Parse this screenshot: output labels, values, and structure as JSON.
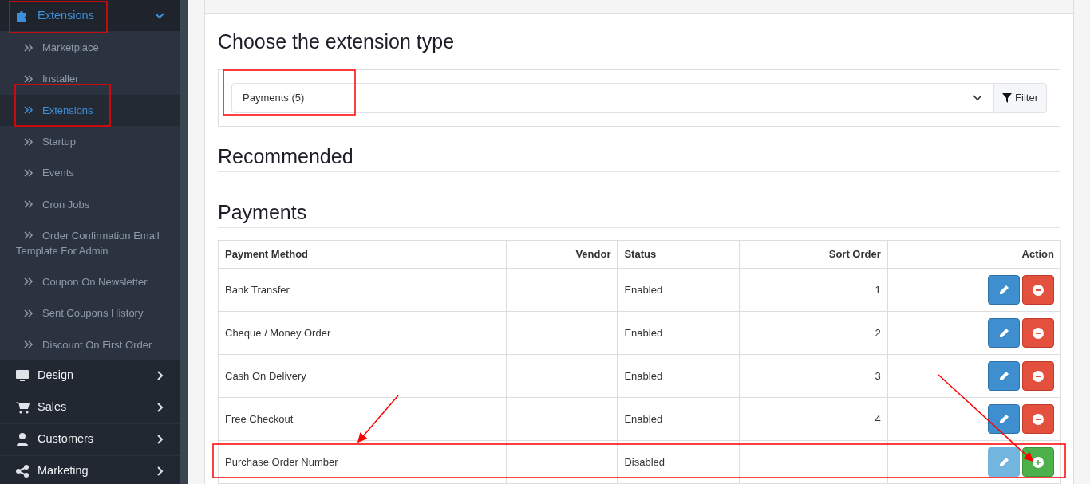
{
  "sidebar": {
    "items": [
      {
        "label": "Extensions",
        "expanded": true,
        "children": [
          {
            "label": "Marketplace",
            "selected": false
          },
          {
            "label": "Installer",
            "selected": false
          },
          {
            "label": "Extensions",
            "selected": true
          },
          {
            "label": "Startup",
            "selected": false
          },
          {
            "label": "Events",
            "selected": false
          },
          {
            "label": "Cron Jobs",
            "selected": false
          },
          {
            "label": "Order Confirmation Email Template For Admin",
            "selected": false
          },
          {
            "label": "Coupon On Newsletter",
            "selected": false
          },
          {
            "label": "Sent Coupons History",
            "selected": false
          },
          {
            "label": "Discount On First Order",
            "selected": false
          }
        ]
      },
      {
        "label": "Design",
        "expanded": false
      },
      {
        "label": "Sales",
        "expanded": false
      },
      {
        "label": "Customers",
        "expanded": false
      },
      {
        "label": "Marketing",
        "expanded": false
      }
    ]
  },
  "main": {
    "type_heading": "Choose the extension type",
    "type_select": {
      "value": "Payments (5)"
    },
    "filter_button": "Filter",
    "recommended_heading": "Recommended",
    "section_heading": "Payments",
    "table": {
      "columns": [
        "Payment Method",
        "Vendor",
        "Status",
        "Sort Order",
        "Action"
      ],
      "rows": [
        {
          "method": "Bank Transfer",
          "status": "Enabled",
          "sort_order": "1",
          "installed": true
        },
        {
          "method": "Cheque / Money Order",
          "status": "Enabled",
          "sort_order": "2",
          "installed": true
        },
        {
          "method": "Cash On Delivery",
          "status": "Enabled",
          "sort_order": "3",
          "installed": true
        },
        {
          "method": "Free Checkout",
          "status": "Enabled",
          "sort_order": "4",
          "installed": true
        },
        {
          "method": "Purchase Order Number",
          "status": "Disabled",
          "installed": false
        }
      ]
    }
  }
}
